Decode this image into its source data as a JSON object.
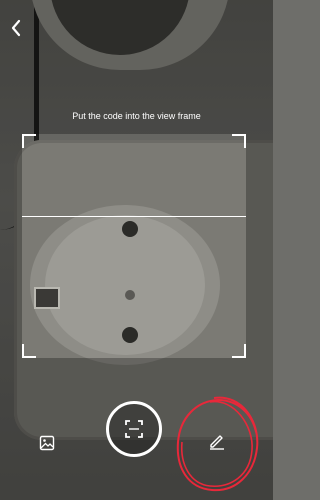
{
  "header": {
    "back_icon": "chevron-left-icon"
  },
  "scanner": {
    "instruction": "Put the code into the view frame"
  },
  "toolbar": {
    "gallery_icon": "image-icon",
    "scan_icon": "scan-frame-icon",
    "edit_icon": "pencil-icon"
  },
  "colors": {
    "overlay_text": "#ffffff",
    "annotation": "#e8283a"
  }
}
